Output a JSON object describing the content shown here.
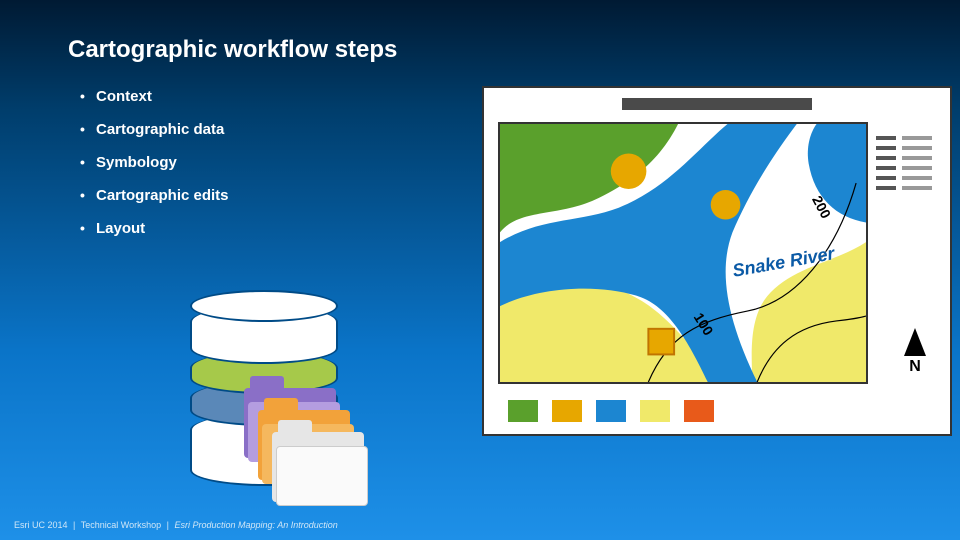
{
  "title": "Cartographic workflow steps",
  "bullets": [
    "Context",
    "Cartographic data",
    "Symbology",
    "Cartographic edits",
    "Layout"
  ],
  "footer": {
    "left": "Esri UC 2014",
    "mid": "Technical Workshop",
    "right": "Esri Production Mapping: An Introduction"
  },
  "map": {
    "river_label": "Snake River",
    "contour_100": "100",
    "contour_200": "200",
    "north_label": "N",
    "swatches": [
      "#5aa02c",
      "#e7a700",
      "#1c86d1",
      "#f0e96a",
      "#e85a1a"
    ]
  }
}
